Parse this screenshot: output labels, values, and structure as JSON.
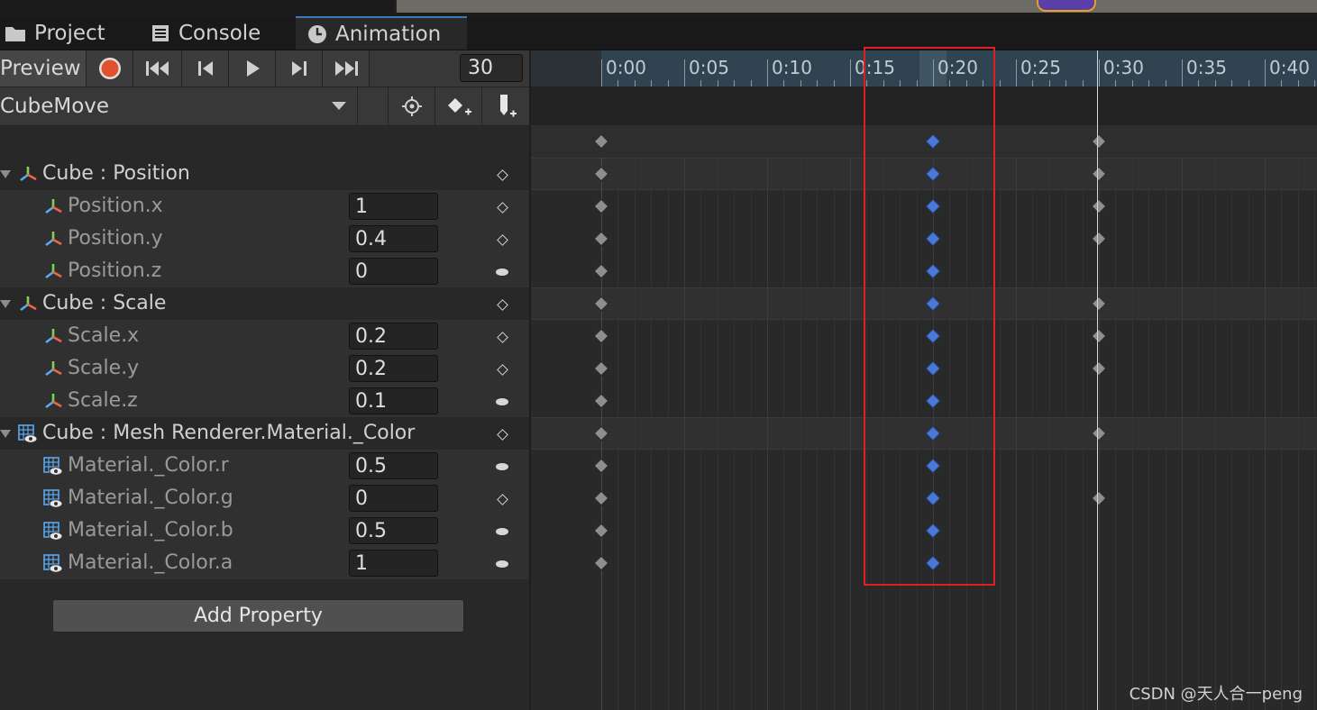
{
  "tabs": [
    {
      "label": "Project",
      "icon": "folder-icon"
    },
    {
      "label": "Console",
      "icon": "console-icon"
    },
    {
      "label": "Animation",
      "icon": "clock-icon",
      "active": true
    }
  ],
  "toolbar": {
    "preview_label": "Preview",
    "frame_value": "30",
    "buttons": [
      "record-icon",
      "first-key-icon",
      "prev-key-icon",
      "play-icon",
      "next-key-icon",
      "last-key-icon"
    ]
  },
  "clip": {
    "name": "CubeMove",
    "buttons": [
      "filter-by-selection-icon",
      "add-keyframe-icon",
      "add-event-icon"
    ]
  },
  "properties": [
    {
      "label": "Cube : Position",
      "level": "group",
      "icon": "transform-icon",
      "value": "",
      "key": "diamond"
    },
    {
      "label": "Position.x",
      "level": "child",
      "icon": "transform-icon",
      "value": "1",
      "key": "diamond"
    },
    {
      "label": "Position.y",
      "level": "child",
      "icon": "transform-icon",
      "value": "0.4",
      "key": "diamond"
    },
    {
      "label": "Position.z",
      "level": "child",
      "icon": "transform-icon",
      "value": "0",
      "key": "oval"
    },
    {
      "label": "Cube : Scale",
      "level": "group",
      "icon": "transform-icon",
      "value": "",
      "key": "diamond"
    },
    {
      "label": "Scale.x",
      "level": "child",
      "icon": "transform-icon",
      "value": "0.2",
      "key": "diamond"
    },
    {
      "label": "Scale.y",
      "level": "child",
      "icon": "transform-icon",
      "value": "0.2",
      "key": "diamond"
    },
    {
      "label": "Scale.z",
      "level": "child",
      "icon": "transform-icon",
      "value": "0.1",
      "key": "oval"
    },
    {
      "label": "Cube : Mesh Renderer.Material._Color",
      "level": "group",
      "icon": "mesh-renderer-icon",
      "value": "",
      "key": "diamond"
    },
    {
      "label": "Material._Color.r",
      "level": "child",
      "icon": "mesh-renderer-icon",
      "value": "0.5",
      "key": "oval"
    },
    {
      "label": "Material._Color.g",
      "level": "child",
      "icon": "mesh-renderer-icon",
      "value": "0",
      "key": "diamond"
    },
    {
      "label": "Material._Color.b",
      "level": "child",
      "icon": "mesh-renderer-icon",
      "value": "0.5",
      "key": "oval"
    },
    {
      "label": "Material._Color.a",
      "level": "child",
      "icon": "mesh-renderer-icon",
      "value": "1",
      "key": "oval"
    }
  ],
  "add_property_label": "Add Property",
  "timeline": {
    "tick_labels": [
      "0:00",
      "0:05",
      "0:10",
      "0:15",
      "0:20",
      "0:25",
      "0:30",
      "0:35",
      "0:40"
    ],
    "summary_keys": [
      0,
      20,
      30
    ],
    "row_keys": [
      [
        0,
        20,
        30
      ],
      [
        0,
        20,
        30
      ],
      [
        0,
        20,
        30
      ],
      [
        0,
        20
      ],
      [
        0,
        20,
        30
      ],
      [
        0,
        20,
        30
      ],
      [
        0,
        20,
        30
      ],
      [
        0,
        20
      ],
      [
        0,
        20,
        30
      ],
      [
        0,
        20
      ],
      [
        0,
        20,
        30
      ],
      [
        0,
        20
      ],
      [
        0,
        20
      ]
    ],
    "selected_frame": 20,
    "current_frame": 30,
    "colors": {
      "selected_key": "#4a78d6",
      "key": "#8e8e8e",
      "highlight": "#e02020"
    }
  },
  "watermark": "CSDN @天人合一peng"
}
